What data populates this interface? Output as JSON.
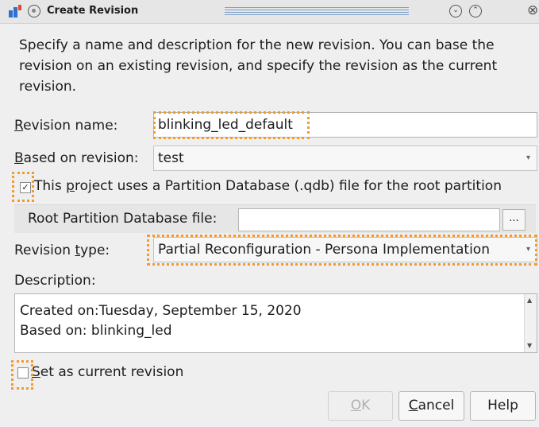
{
  "window": {
    "title": "Create Revision"
  },
  "intro_text": "Specify a name and description for the new revision. You can base the revision on an existing revision, and specify the revision as the current revision.",
  "revision_name": {
    "label_mnemonic": "R",
    "label_rest": "evision name:",
    "value": "blinking_led_default"
  },
  "based_on": {
    "label_mnemonic": "B",
    "label_rest": "ased on revision:",
    "value": "test"
  },
  "qdb_checkbox": {
    "label_before": "This ",
    "label_mnemonic": "p",
    "label_after": "roject uses a Partition Database (.qdb) file for the root partition",
    "checked": true,
    "check_glyph": "✓"
  },
  "root_partition": {
    "label": "Root Partition Database file:",
    "value": "",
    "browse_label": "..."
  },
  "revision_type": {
    "label_before": "Revision ",
    "label_mnemonic": "t",
    "label_after": "ype:",
    "value": "Partial Reconfiguration - Persona Implementation"
  },
  "description": {
    "label": "Description:",
    "lines": [
      "Created on:Tuesday, September 15, 2020",
      "Based on: blinking_led"
    ]
  },
  "current_checkbox": {
    "label_mnemonic": "S",
    "label_rest": "et as current revision",
    "checked": false
  },
  "buttons": {
    "ok": {
      "mnemonic": "O",
      "rest": "K",
      "enabled": false
    },
    "cancel": {
      "mnemonic": "C",
      "rest": "ancel"
    },
    "help": {
      "label": "Help"
    }
  },
  "colors": {
    "highlight": "#f19a2e",
    "titlebar": "#e6e6e6",
    "dialog_bg": "#efefef"
  }
}
